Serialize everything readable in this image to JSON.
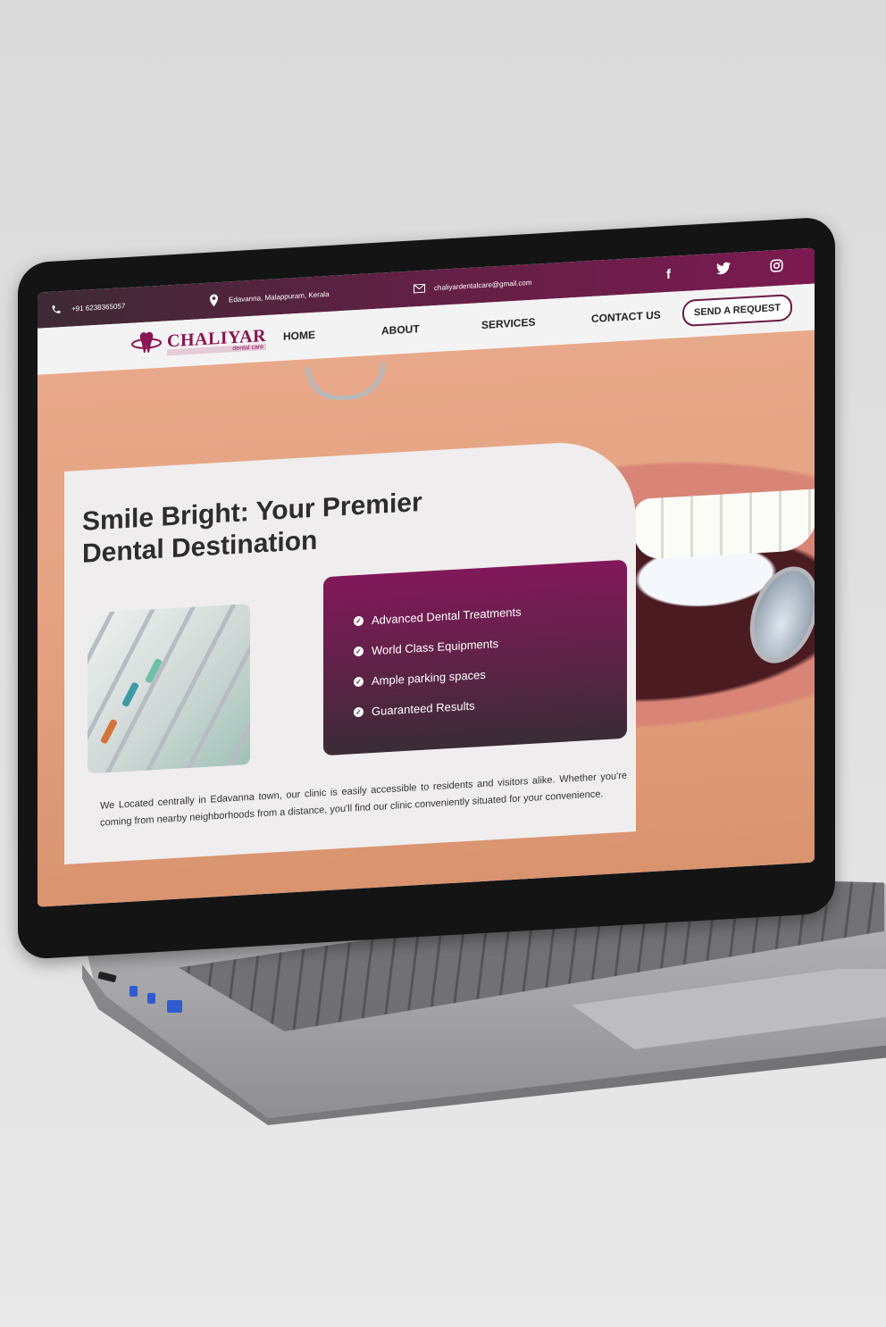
{
  "topbar": {
    "phone": "+91 6238365057",
    "location": "Edavanna, Malappuram, Kerala",
    "email": "chaliyardentalcare@gmail.com",
    "social": [
      "facebook",
      "twitter",
      "instagram"
    ]
  },
  "brand": {
    "name": "CHALIYAR",
    "tagline": "dental care",
    "logo_icon": "tooth-icon"
  },
  "nav": {
    "links": [
      "HOME",
      "ABOUT",
      "SERVICES",
      "CONTACT US"
    ],
    "cta": "SEND A REQUEST"
  },
  "hero": {
    "title": "Smile Bright: Your Premier Dental Destination",
    "features": [
      "Advanced Dental Treatments",
      "World Class Equipments",
      "Ample parking spaces",
      "Guaranteed Results"
    ],
    "blurb": "We Located centrally in Edavanna town, our clinic is easily accessible to residents and visitors alike. Whether you're coming from nearby neighborhoods from a distance, you'll find our clinic conveniently situated for your convenience."
  },
  "colors": {
    "brand": "#7b1a50",
    "topbar_dark": "#3d2a33",
    "text_dark": "#2d2d2d"
  }
}
